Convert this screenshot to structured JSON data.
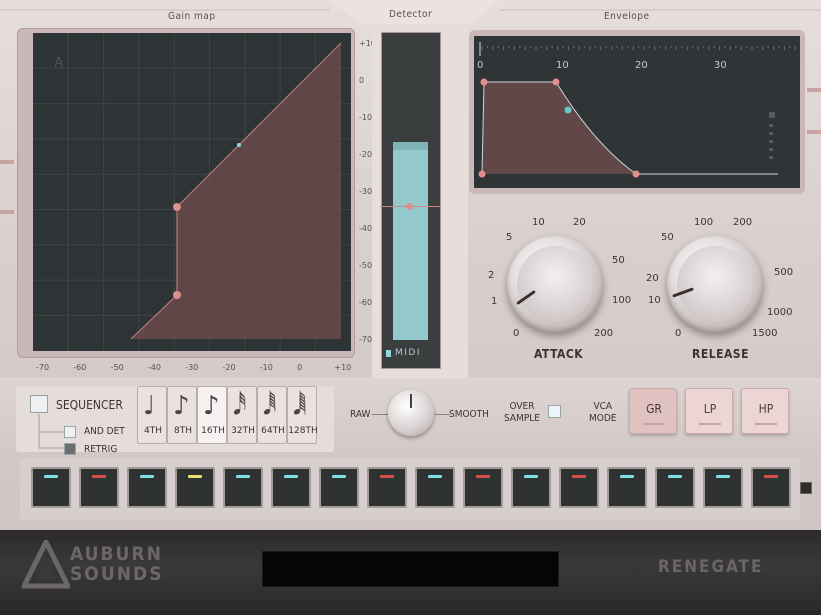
{
  "plugin": {
    "brand": "AUBURN\nSOUNDS",
    "product": "RENEGATE"
  },
  "sections": {
    "gain_map": "Gain map",
    "detector": "Detector",
    "envelope": "Envelope"
  },
  "gain_map": {
    "x_ticks": [
      "-70",
      "-60",
      "-50",
      "-40",
      "-30",
      "-20",
      "-10",
      "0",
      "+10"
    ],
    "y_ticks": [
      "+10",
      "0",
      "-10",
      "-20",
      "-30",
      "-40",
      "-50",
      "-60",
      "-70"
    ],
    "corner_badge": "A"
  },
  "detector": {
    "midi_label": "MIDI"
  },
  "envelope": {
    "ticks": [
      "0",
      "10",
      "20",
      "30"
    ]
  },
  "attack": {
    "label": "ATTACK",
    "scale": [
      "0",
      "1",
      "2",
      "5",
      "10",
      "20",
      "50",
      "100",
      "200"
    ]
  },
  "release": {
    "label": "RELEASE",
    "scale": [
      "0",
      "10",
      "20",
      "50",
      "100",
      "200",
      "500",
      "1000",
      "1500"
    ]
  },
  "sequencer": {
    "label": "SEQUENCER",
    "and_det": "AND DET",
    "retrig": "RETRIG",
    "notes": [
      {
        "glyph": "♩",
        "label": "4TH"
      },
      {
        "glyph": "♪",
        "label": "8TH"
      },
      {
        "glyph": "♪",
        "label": "16TH"
      },
      {
        "glyph": "𝅘𝅥𝅰",
        "label": "32TH"
      },
      {
        "glyph": "𝅘𝅥𝅱",
        "label": "64TH"
      },
      {
        "glyph": "𝅘𝅥𝅲",
        "label": "128TH"
      }
    ],
    "selected_note": "16TH"
  },
  "smoothing": {
    "raw": "RAW",
    "smooth": "SMOOTH"
  },
  "oversample": {
    "label": "OVER\nSAMPLE"
  },
  "vca_mode": {
    "label": "VCA\nMODE",
    "buttons": [
      "GR",
      "LP",
      "HP"
    ],
    "selected": "GR"
  },
  "steps": {
    "led_colors": [
      "#7fe0e6",
      "#d8504e",
      "#7fe0e6",
      "#e8e06a",
      "#7fe0e6",
      "#7fe0e6",
      "#7fe0e6",
      "#d8504e",
      "#7fe0e6",
      "#d8504e",
      "#7fe0e6",
      "#d8504e",
      "#7fe0e6",
      "#7fe0e6",
      "#7fe0e6",
      "#d8504e"
    ]
  },
  "colors": {
    "accent_pink": "#e08f8d",
    "accent_cyan": "#8fd8e0"
  }
}
